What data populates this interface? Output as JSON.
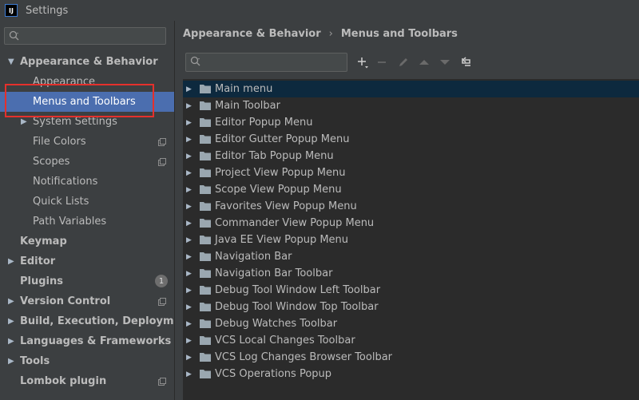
{
  "window": {
    "title": "Settings",
    "app_icon": "intellij-idea-icon"
  },
  "sidebar": {
    "search_placeholder": "",
    "items": [
      {
        "label": "Appearance & Behavior",
        "level": 0,
        "bold": true,
        "expanded": true,
        "has_arrow": true
      },
      {
        "label": "Appearance",
        "level": 1
      },
      {
        "label": "Menus and Toolbars",
        "level": 1,
        "selected": true
      },
      {
        "label": "System Settings",
        "level": 1,
        "has_arrow": true
      },
      {
        "label": "File Colors",
        "level": 1,
        "copy_icon": true
      },
      {
        "label": "Scopes",
        "level": 1,
        "copy_icon": true
      },
      {
        "label": "Notifications",
        "level": 1
      },
      {
        "label": "Quick Lists",
        "level": 1
      },
      {
        "label": "Path Variables",
        "level": 1
      },
      {
        "label": "Keymap",
        "level": 0,
        "bold": true
      },
      {
        "label": "Editor",
        "level": 0,
        "bold": true,
        "has_arrow": true
      },
      {
        "label": "Plugins",
        "level": 0,
        "bold": true,
        "badge": "1"
      },
      {
        "label": "Version Control",
        "level": 0,
        "bold": true,
        "has_arrow": true,
        "copy_icon": true
      },
      {
        "label": "Build, Execution, Deployment",
        "level": 0,
        "bold": true,
        "has_arrow": true
      },
      {
        "label": "Languages & Frameworks",
        "level": 0,
        "bold": true,
        "has_arrow": true
      },
      {
        "label": "Tools",
        "level": 0,
        "bold": true,
        "has_arrow": true
      },
      {
        "label": "Lombok plugin",
        "level": 0,
        "bold": true,
        "copy_icon": true
      }
    ]
  },
  "breadcrumb": {
    "parent": "Appearance & Behavior",
    "separator": "›",
    "current": "Menus and Toolbars"
  },
  "toolbar": {
    "search_placeholder": "",
    "buttons": [
      "add-icon",
      "remove-icon",
      "edit-icon",
      "move-up-icon",
      "move-down-icon",
      "restore-icon"
    ]
  },
  "actions_tree": {
    "items": [
      "Main menu",
      "Main Toolbar",
      "Editor Popup Menu",
      "Editor Gutter Popup Menu",
      "Editor Tab Popup Menu",
      "Project View Popup Menu",
      "Scope View Popup Menu",
      "Favorites View Popup Menu",
      "Commander View Popup Menu",
      "Java EE View Popup Menu",
      "Navigation Bar",
      "Navigation Bar Toolbar",
      "Debug Tool Window Left Toolbar",
      "Debug Tool Window Top Toolbar",
      "Debug Watches Toolbar",
      "VCS Local Changes Toolbar",
      "VCS Log Changes Browser Toolbar",
      "VCS Operations Popup"
    ],
    "selected_index": 0
  },
  "colors": {
    "selection": "#4b6eaf",
    "annotation": "#e5302c",
    "list_bg": "#2b2b2b",
    "panel_bg": "#3c3f41"
  }
}
